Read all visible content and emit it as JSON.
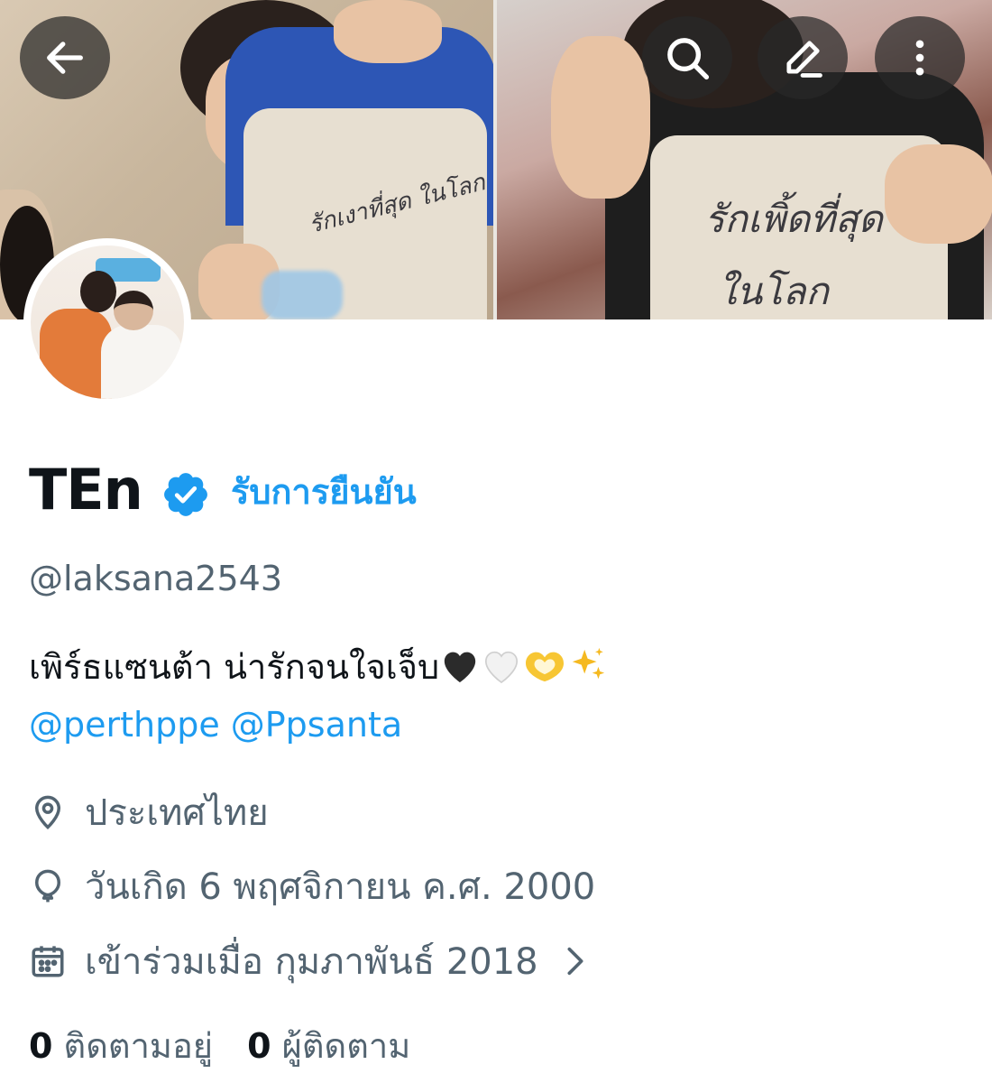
{
  "profile": {
    "name": "TEn",
    "verify_label": "รับการยืนยัน",
    "handle": "@laksana2543",
    "bio_text": "เพิร์ธแซนต้า น่ารักจนใจเจ็บ",
    "bio_emojis": [
      "black-heart",
      "white-heart",
      "heart-hands",
      "sparkles"
    ],
    "mentions": [
      "@perthppe",
      "@Ppsanta"
    ],
    "location": "ประเทศไทย",
    "birthday": "วันเกิด 6 พฤศจิกายน ค.ศ. 2000",
    "joined": "เข้าร่วมเมื่อ กุมภาพันธ์ 2018",
    "following_count": "0",
    "following_label": "ติดตามอยู่",
    "followers_count": "0",
    "followers_label": "ผู้ติดตาม"
  },
  "banner": {
    "left_shirt_text": "รักเงาที่สุด ในโลก",
    "right_shirt_text_line1": "รักเพิ้ดที่สุด",
    "right_shirt_text_line2": "ในโลก"
  },
  "icons": {
    "back": "arrow-left-icon",
    "search": "search-icon",
    "edit": "pencil-icon",
    "more": "more-vertical-icon",
    "verified": "verified-badge-icon",
    "location": "location-pin-icon",
    "birthday": "balloon-icon",
    "joined": "calendar-icon",
    "chevron": "chevron-right-icon"
  },
  "colors": {
    "accent": "#1d9bf0",
    "text_primary": "#0f1419",
    "text_secondary": "#536471"
  }
}
